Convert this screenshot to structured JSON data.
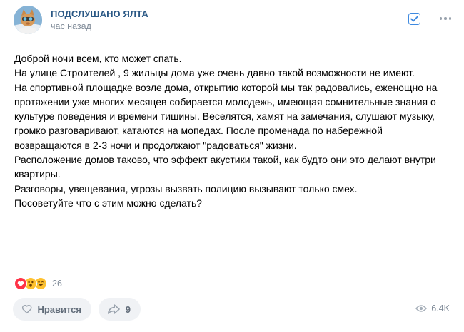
{
  "post": {
    "author": "ПОДСЛУШАНО ЯЛТА",
    "time": "час назад",
    "icons": {
      "avatar": "cat-avatar",
      "subscribed": "check-icon",
      "menu": "more-icon"
    },
    "text": [
      "Доброй ночи всем, кто может спать.",
      "На улице Строителей , 9 жильцы дома уже очень давно такой возможности не имеют.",
      "На спортивной площадке возле дома, открытию которой мы так радовались, еженощно на протяжении уже многих месяцев собирается молодежь, имеющая сомнительные знания о культуре поведения и времени тишины. Веселятся, хамят на замечания, слушают музыку, громко разговаривают, катаются на мопедах. После променада по набережной возвращаются в 2-3 ночи и продолжают \"радоваться\" жизни.",
      "Расположение домов таково, что эффект акустики такой, как будто они это делают внутри квартиры.",
      "Разговоры, увещевания, угрозы вызвать полицию вызывают только смех.",
      "Посоветуйте что с этим можно сделать?"
    ],
    "reactions": {
      "icons": [
        "heart-reaction-icon",
        "wow-reaction-icon",
        "laugh-reaction-icon"
      ],
      "count": "26"
    },
    "like_button": {
      "label": "Нравится",
      "icon": "heart-outline-icon"
    },
    "share_button": {
      "count": "9",
      "icon": "share-arrow-icon"
    },
    "views": {
      "count": "6.4K",
      "icon": "eye-icon"
    }
  },
  "colors": {
    "author": "#2a5885",
    "secondary": "#818c99",
    "accent": "#3f8ae0",
    "button_bg": "#f0f2f5"
  }
}
